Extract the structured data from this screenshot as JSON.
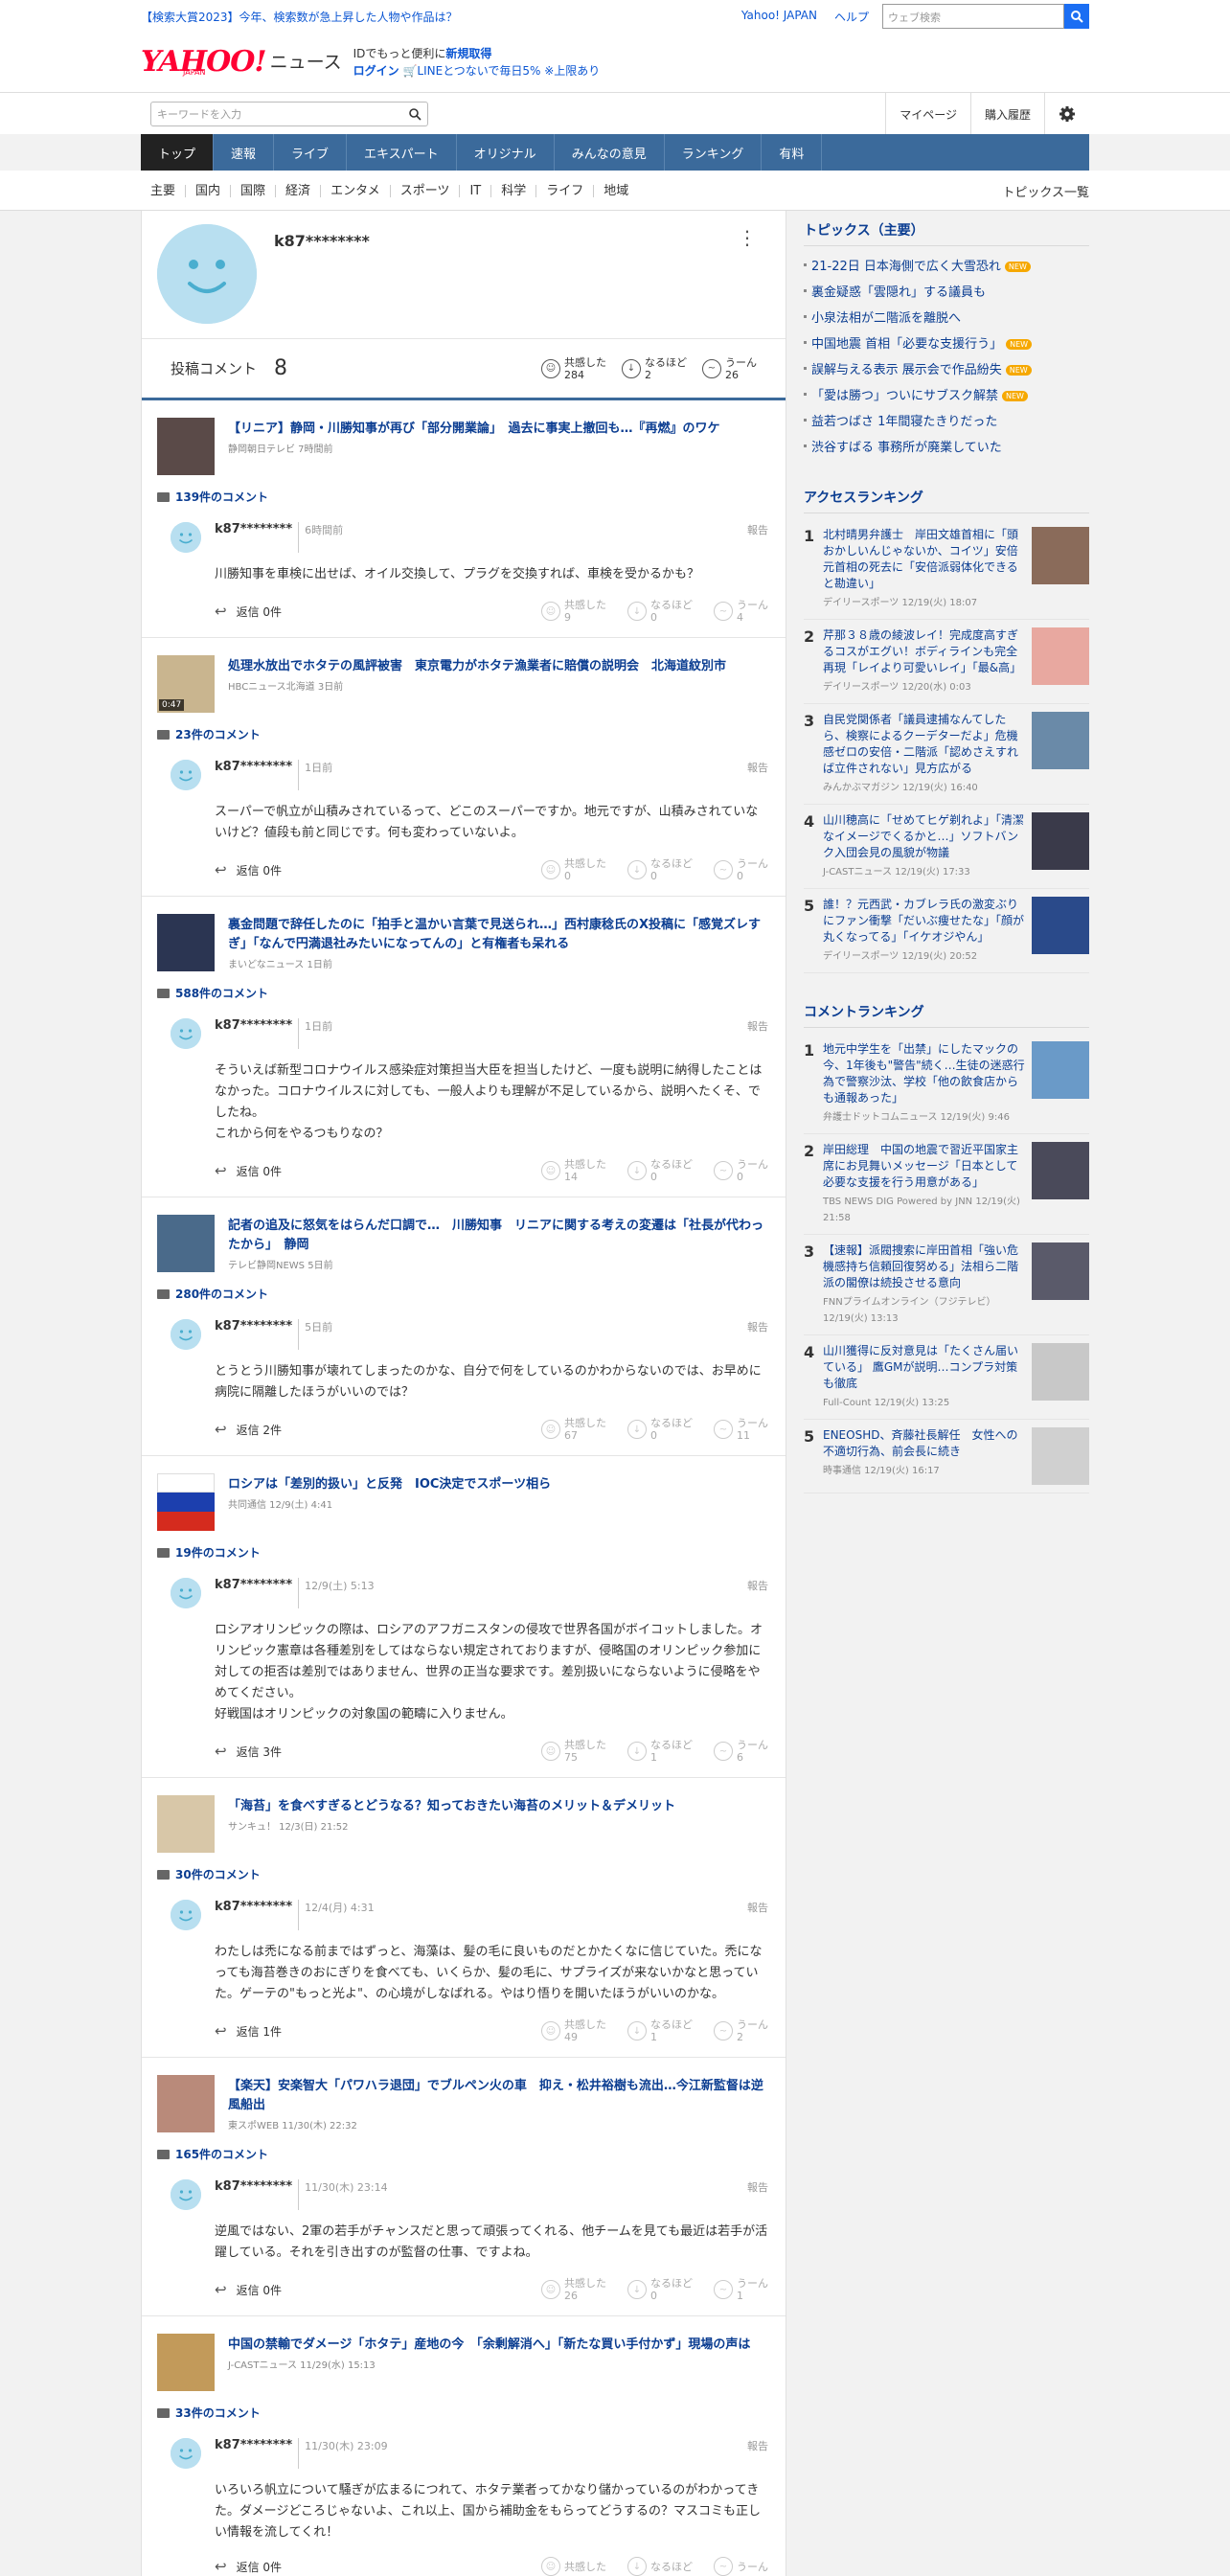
{
  "topbar": {
    "promo": "【検索大賞2023】今年、検索数が急上昇した人物や作品は？",
    "links": [
      "Yahoo! JAPAN",
      "ヘルプ"
    ],
    "web_search_placeholder": "ウェブ検索"
  },
  "header": {
    "logo_text": "YAHOO!",
    "logo_sub": "JAPAN",
    "logo_news": "ニュース",
    "line1_pre": "IDでもっと便利に",
    "line1_link": "新規取得",
    "line2_login": "ログイン",
    "line2_text": "LINEとつないで毎日5% ※上限あり"
  },
  "search": {
    "placeholder": "キーワードを入力",
    "mypage": "マイページ",
    "history": "購入履歴"
  },
  "gnav": [
    "トップ",
    "速報",
    "ライブ",
    "エキスパート",
    "オリジナル",
    "みんなの意見",
    "ランキング",
    "有料"
  ],
  "snav": [
    "主要",
    "国内",
    "国際",
    "経済",
    "エンタメ",
    "スポーツ",
    "IT",
    "科学",
    "ライフ",
    "地域"
  ],
  "snav_all": "トピックス一覧",
  "profile": {
    "username": "k87********",
    "post_label": "投稿コメント",
    "post_count": "8",
    "reacts": [
      {
        "label": "共感した",
        "value": "284"
      },
      {
        "label": "なるほど",
        "value": "2"
      },
      {
        "label": "うーん",
        "value": "26"
      }
    ]
  },
  "items": [
    {
      "title": "【リニア】静岡・川勝知事が再び「部分開業論」　過去に事実上撤回も…『再燃』のワケ",
      "source": "静岡朝日テレビ 7時間前",
      "comments": "139件のコメント",
      "user": "k87********",
      "time": "6時間前",
      "report": "報告",
      "body": "川勝知事を車検に出せば、オイル交換して、プラグを交換すれば、車検を受かるかも？",
      "reply": "返信 0件",
      "r": [
        {
          "l": "共感した",
          "v": "9"
        },
        {
          "l": "なるほど",
          "v": "0"
        },
        {
          "l": "うーん",
          "v": "4"
        }
      ],
      "thumb": "#5a4a48"
    },
    {
      "title": "処理水放出でホタテの風評被害　東京電力がホタテ漁業者に賠償の説明会　北海道紋別市",
      "source": "HBCニュース北海道 3日前",
      "comments": "23件のコメント",
      "user": "k87********",
      "time": "1日前",
      "report": "報告",
      "body": "スーパーで帆立が山積みされているって、どこのスーパーですか。地元ですが、山積みされていないけど？値段も前と同じです。何も変わっていないよ。",
      "reply": "返信 0件",
      "r": [
        {
          "l": "共感した",
          "v": "0"
        },
        {
          "l": "なるほど",
          "v": "0"
        },
        {
          "l": "うーん",
          "v": "0"
        }
      ],
      "thumb": "#c9b58f",
      "video": "0:47"
    },
    {
      "title": "裏金問題で辞任したのに「拍手と温かい言葉で見送られ…」西村康稔氏のX投稿に「感覚ズレすぎ」「なんで円満退社みたいになってんの」と有権者も呆れる",
      "source": "まいどなニュース 1日前",
      "comments": "588件のコメント",
      "user": "k87********",
      "time": "1日前",
      "report": "報告",
      "body": "そういえば新型コロナウイルス感染症対策担当大臣を担当したけど、一度も説明に納得したことはなかった。コロナウイルスに対しても、一般人よりも理解が不足しているから、説明へたくそ、でしたね。\nこれから何をやるつもりなの？",
      "reply": "返信 0件",
      "r": [
        {
          "l": "共感した",
          "v": "14"
        },
        {
          "l": "なるほど",
          "v": "0"
        },
        {
          "l": "うーん",
          "v": "0"
        }
      ],
      "thumb": "#2b3552"
    },
    {
      "title": "記者の追及に怒気をはらんだ口調で…　川勝知事　リニアに関する考えの変遷は「社長が代わったから」　静岡",
      "source": "テレビ静岡NEWS 5日前",
      "comments": "280件のコメント",
      "user": "k87********",
      "time": "5日前",
      "report": "報告",
      "body": "とうとう川勝知事が壊れてしまったのかな、自分で何をしているのかわからないのでは、お早めに病院に隔離したほうがいいのでは？",
      "reply": "返信 2件",
      "r": [
        {
          "l": "共感した",
          "v": "67"
        },
        {
          "l": "なるほど",
          "v": "0"
        },
        {
          "l": "うーん",
          "v": "11"
        }
      ],
      "thumb": "#4a6a8a"
    },
    {
      "title": "ロシアは「差別的扱い」と反発　IOC決定でスポーツ相ら",
      "source": "共同通信 12/9(土) 4:41",
      "comments": "19件のコメント",
      "user": "k87********",
      "time": "12/9(土) 5:13",
      "report": "報告",
      "body": "ロシアオリンピックの際は、ロシアのアフガニスタンの侵攻で世界各国がボイコットしました。オリンピック憲章は各種差別をしてはならない規定されておりますが、侵略国のオリンピック参加に対しての拒否は差別ではありません、世界の正当な要求です。差別扱いにならないように侵略をやめてください。\n好戦国はオリンピックの対象国の範疇に入りません。",
      "reply": "返信 3件",
      "r": [
        {
          "l": "共感した",
          "v": "75"
        },
        {
          "l": "なるほど",
          "v": "1"
        },
        {
          "l": "うーん",
          "v": "6"
        }
      ],
      "thumb": "flag"
    },
    {
      "title": "「海苔」を食べすぎるとどうなる？知っておきたい海苔のメリット＆デメリット",
      "source": "サンキュ！ 12/3(日) 21:52",
      "comments": "30件のコメント",
      "user": "k87********",
      "time": "12/4(月) 4:31",
      "report": "報告",
      "body": "わたしは禿になる前まではずっと、海藻は、髪の毛に良いものだとかたくなに信じていた。禿になっても海苔巻きのおにぎりを食べても、いくらか、髪の毛に、サプライズが来ないかなと思っていた。ゲーテの\"もっと光よ\"、の心境がしなばれる。やはり悟りを開いたほうがいいのかな。",
      "reply": "返信 1件",
      "r": [
        {
          "l": "共感した",
          "v": "49"
        },
        {
          "l": "なるほど",
          "v": "1"
        },
        {
          "l": "うーん",
          "v": "2"
        }
      ],
      "thumb": "#d8c7a8"
    },
    {
      "title": "【楽天】安楽智大「パワハラ退団」でブルペン火の車　抑え・松井裕樹も流出…今江新監督は逆風船出",
      "source": "東スポWEB 11/30(木) 22:32",
      "comments": "165件のコメント",
      "user": "k87********",
      "time": "11/30(木) 23:14",
      "report": "報告",
      "body": "逆風ではない、2軍の若手がチャンスだと思って頑張ってくれる、他チームを見ても最近は若手が活躍している。それを引き出すのが監督の仕事、ですよね。",
      "reply": "返信 0件",
      "r": [
        {
          "l": "共感した",
          "v": "26"
        },
        {
          "l": "なるほど",
          "v": "0"
        },
        {
          "l": "うーん",
          "v": "1"
        }
      ],
      "thumb": "#b98a7a"
    },
    {
      "title": "中国の禁輸でダメージ「ホタテ」産地の今　「余剰解消へ」「新たな買い手付かず」現場の声は",
      "source": "J-CASTニュース 11/29(水) 15:13",
      "comments": "33件のコメント",
      "user": "k87********",
      "time": "11/30(木) 23:09",
      "report": "報告",
      "body": "いろいろ帆立について騒ぎが広まるにつれて、ホタテ業者ってかなり儲かっているのがわかってきた。ダメージどころじゃないよ、これ以上、国から補助金をもらってどうするの？マスコミも正しい情報を流してくれ！",
      "reply": "返信 0件",
      "r": [
        {
          "l": "共感した",
          "v": ""
        },
        {
          "l": "なるほど",
          "v": ""
        },
        {
          "l": "うーん",
          "v": ""
        }
      ],
      "thumb": "#c29a5a"
    }
  ],
  "topics": {
    "title": "トピックス（主要）",
    "items": [
      {
        "text": "21-22日 日本海側で広く大雪恐れ",
        "new": true
      },
      {
        "text": "裏金疑惑「雲隠れ」する議員も",
        "new": false
      },
      {
        "text": "小泉法相が二階派を離脱へ",
        "new": false
      },
      {
        "text": "中国地震 首相「必要な支援行う」",
        "new": true
      },
      {
        "text": "誤解与える表示 展示会で作品紛失",
        "new": true
      },
      {
        "text": "「愛は勝つ」ついにサブスク解禁",
        "new": true
      },
      {
        "text": "益若つばさ 1年間寝たきりだった",
        "new": false
      },
      {
        "text": "渋谷すばる 事務所が廃業していた",
        "new": false
      }
    ],
    "new_label": "NEW"
  },
  "access_ranking": {
    "title": "アクセスランキング",
    "items": [
      {
        "n": "1",
        "t": "北村晴男弁護士　岸田文雄首相に「頭おかしいんじゃないか、コイツ」安倍元首相の死去に「安倍派弱体化できると勘違い」",
        "m": "デイリースポーツ 12/19(火) 18:07",
        "c": "#8a6b5a"
      },
      {
        "n": "2",
        "t": "芹那３８歳の綾波レイ！完成度高すぎるコスがエグい！ボディラインも完全再現「レイより可愛いレイ」「最&高」",
        "m": "デイリースポーツ 12/20(水) 0:03",
        "c": "#e8a8a0"
      },
      {
        "n": "3",
        "t": "自民党関係者「議員逮捕なんてしたら、検察によるクーデターだよ」危機感ゼロの安倍・二階派「認めさえすれば立件されない」見方広がる",
        "m": "みんかぶマガジン 12/19(火) 16:40",
        "c": "#6a8aa8"
      },
      {
        "n": "4",
        "t": "山川穂高に「せめてヒゲ剃れよ」「清潔なイメージでくるかと…」ソフトバンク入団会見の風貌が物議",
        "m": "J-CASTニュース 12/19(火) 17:33",
        "c": "#3a3a4a"
      },
      {
        "n": "5",
        "t": "誰！？元西武・カブレラ氏の激変ぶりにファン衝撃「だいぶ痩せたな」「顔が丸くなってる」「イケオジやん」",
        "m": "デイリースポーツ 12/19(火) 20:52",
        "c": "#2a4a8a"
      }
    ]
  },
  "comment_ranking": {
    "title": "コメントランキング",
    "items": [
      {
        "n": "1",
        "t": "地元中学生を「出禁」にしたマックの今、1年後も\"警告\"続く…生徒の迷惑行為で警察沙汰、学校「他の飲食店からも通報あった」",
        "m": "弁護士ドットコムニュース 12/19(火) 9:46",
        "c": "#6a9ac8"
      },
      {
        "n": "2",
        "t": "岸田総理　中国の地震で習近平国家主席にお見舞いメッセージ「日本として必要な支援を行う用意がある」",
        "m": "TBS NEWS DIG Powered by JNN 12/19(火) 21:58",
        "c": "#4a4a5a"
      },
      {
        "n": "3",
        "t": "【速報】派閥捜索に岸田首相「強い危機感持ち信頼回復努める」法相ら二階派の閣僚は続投させる意向",
        "m": "FNNプライムオンライン（フジテレビ） 12/19(火) 13:13",
        "c": "#5a5a6a"
      },
      {
        "n": "4",
        "t": "山川獲得に反対意見は「たくさん届いている」 鷹GMが説明…コンプラ対策も徹底",
        "m": "Full-Count 12/19(火) 13:25",
        "c": "#c8c8c8"
      },
      {
        "n": "5",
        "t": "ENEOSHD、斉藤社長解任　女性への不適切行為、前会長に続き",
        "m": "時事通信 12/19(火) 16:17",
        "c": "#d0d0d0"
      }
    ]
  }
}
